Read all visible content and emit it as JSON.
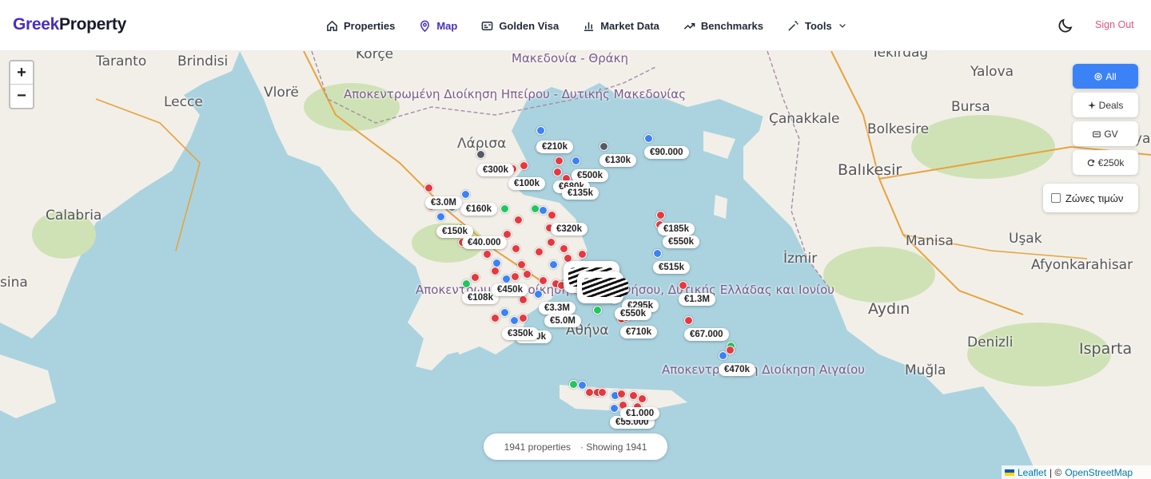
{
  "brand": {
    "part1": "Greek",
    "part2": "Property"
  },
  "nav": [
    {
      "label": "Properties",
      "icon": "home-icon",
      "active": false
    },
    {
      "label": "Map",
      "icon": "map-pin-icon",
      "active": true
    },
    {
      "label": "Golden Visa",
      "icon": "id-card-icon",
      "active": false
    },
    {
      "label": "Market Data",
      "icon": "bar-chart-icon",
      "active": false
    },
    {
      "label": "Benchmarks",
      "icon": "trending-up-icon",
      "active": false
    },
    {
      "label": "Tools",
      "icon": "wand-icon",
      "active": false
    }
  ],
  "signout": "Sign Out",
  "zoom": {
    "in": "+",
    "out": "−"
  },
  "filters": [
    {
      "label": "All",
      "icon": "target-icon",
      "active": true
    },
    {
      "label": "Deals",
      "icon": "sparkle-icon",
      "active": false
    },
    {
      "label": "GV",
      "icon": "passport-icon",
      "active": false
    },
    {
      "label": "€250k",
      "icon": "refresh-icon",
      "active": false
    }
  ],
  "zones_label": "Ζώνες τιμών",
  "status": {
    "count": "1941 properties",
    "showing": "· Showing 1941"
  },
  "attribution": {
    "leaflet": "Leaflet",
    "sep": "| ©",
    "osm": "OpenStreetMap"
  },
  "places": [
    {
      "text": "Taranto",
      "size": "sm"
    },
    {
      "text": "Brindisi",
      "size": "sm"
    },
    {
      "text": "Lecce",
      "size": "sm"
    },
    {
      "text": "Vlorë",
      "size": "sm"
    },
    {
      "text": "Korçe",
      "size": "sm"
    },
    {
      "text": "Calabria",
      "size": "sm"
    },
    {
      "text": "Λάρισα",
      "size": "sm"
    },
    {
      "text": "Αθήνα",
      "size": "sm"
    },
    {
      "text": "Yalova",
      "size": "sm"
    },
    {
      "text": "Bursa",
      "size": "sm"
    },
    {
      "text": "Balıkesir",
      "size": "lg"
    },
    {
      "text": "Çanakkale",
      "size": "sm"
    },
    {
      "text": "Manisa",
      "size": "sm"
    },
    {
      "text": "Uşak",
      "size": "sm"
    },
    {
      "text": "Afyonkarahisar",
      "size": "sm"
    },
    {
      "text": "İzmir",
      "size": "sm"
    },
    {
      "text": "Aydın",
      "size": "lg"
    },
    {
      "text": "Denizli",
      "size": "sm"
    },
    {
      "text": "Isparta",
      "size": "lg"
    },
    {
      "text": "Muğla",
      "size": "sm"
    },
    {
      "text": "Kütahya",
      "size": "sm"
    },
    {
      "text": "Tekirdağ",
      "size": "sm"
    },
    {
      "text": "Bolkesire",
      "size": "sm"
    },
    {
      "text": "sina",
      "size": "sm"
    }
  ],
  "regions": [
    "Μακεδονία - Θράκη",
    "Αποκεντρωμένη Διοίκηση Ηπείρου - Δυτικής Μακεδονίας",
    "Αποκεντρωμένη Διοίκηση Πελοποννήσου, Δυτικής Ελλάδας και Ιονίου",
    "Αποκεντρωμένη Διοίκηση Αιγαίου"
  ],
  "price_labels": [
    "€210k",
    "€90.000",
    "€130k",
    "€300k",
    "€500k",
    "€100k",
    "€680k",
    "€135k",
    "€160k",
    "€3.0M",
    "€320k",
    "€185k",
    "€550k",
    "€515k",
    "€1.3M",
    "€108k",
    "€3.3M",
    "€5.0M",
    "€350k",
    "€350k",
    "€710k",
    "€67.000",
    "€470k",
    "€55.000",
    "€1.000",
    "€295k",
    "€450k",
    "€150k",
    "€40.000",
    "€550k"
  ],
  "colors": {
    "brand": "#4a2fbd",
    "accent": "#3b82f6",
    "signout": "#e0567a",
    "sea": "#aad3df",
    "land": "#f2efe9",
    "forest": "#c8dfb0",
    "marker_red": "#e5393f",
    "marker_blue": "#3b82f6",
    "marker_green": "#22c55e"
  }
}
